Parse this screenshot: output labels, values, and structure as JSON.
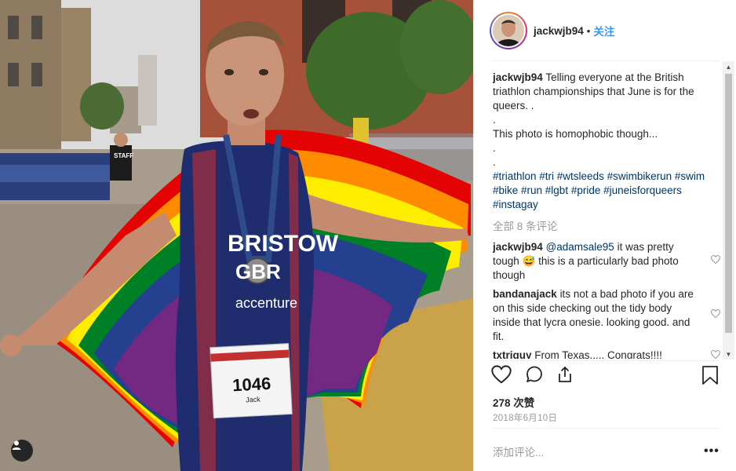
{
  "post": {
    "username": "jackwjb94",
    "follow_label": "关注",
    "header_separator": "•"
  },
  "caption": {
    "username": "jackwjb94",
    "lines": [
      "Telling everyone at the British triathlon championships that June is for the queers. .",
      ".",
      "This photo is homophobic though...",
      ".",
      "."
    ],
    "hashtags": "#triathlon #tri #wtsleeds #swimbikerun #swim #bike #run #lgbt #pride #juneisforqueers #instagay"
  },
  "view_all_comments": "全部 8 条评论",
  "comments": [
    {
      "username": "jackwjb94",
      "mention": "@adamsale95",
      "text_before_emoji": "it was pretty tough",
      "emoji": "😅",
      "text_after_emoji": "this is a particularly bad photo though"
    },
    {
      "username": "bandanajack",
      "text": "its not a bad photo if you are on this side checking out the tidy body inside that lycra onesie. looking good. and fit."
    },
    {
      "username": "txtriguy",
      "text": "From Texas..... Congrats!!!!"
    }
  ],
  "likes_text": "278 次赞",
  "date_text": "2018年6月10日",
  "add_comment_placeholder": "添加评论...",
  "more_glyph": "•••",
  "photo": {
    "jersey_sponsor": "accenture",
    "jersey_name": "BRISTOW",
    "jersey_country": "GBR",
    "bib_number": "1046",
    "bib_name": "Jack",
    "sign_left": "STAFF"
  },
  "icons": {
    "header": [
      "avatar"
    ],
    "actions": [
      "heart-icon",
      "comment-icon",
      "share-icon",
      "bookmark-icon"
    ],
    "comment_like": "heart-outline-icon",
    "photo_overlay": "user-tag-icon"
  },
  "colors": {
    "link_blue": "#3897f0",
    "hashtag_blue": "#003569",
    "text": "#262626",
    "muted": "#999999"
  }
}
